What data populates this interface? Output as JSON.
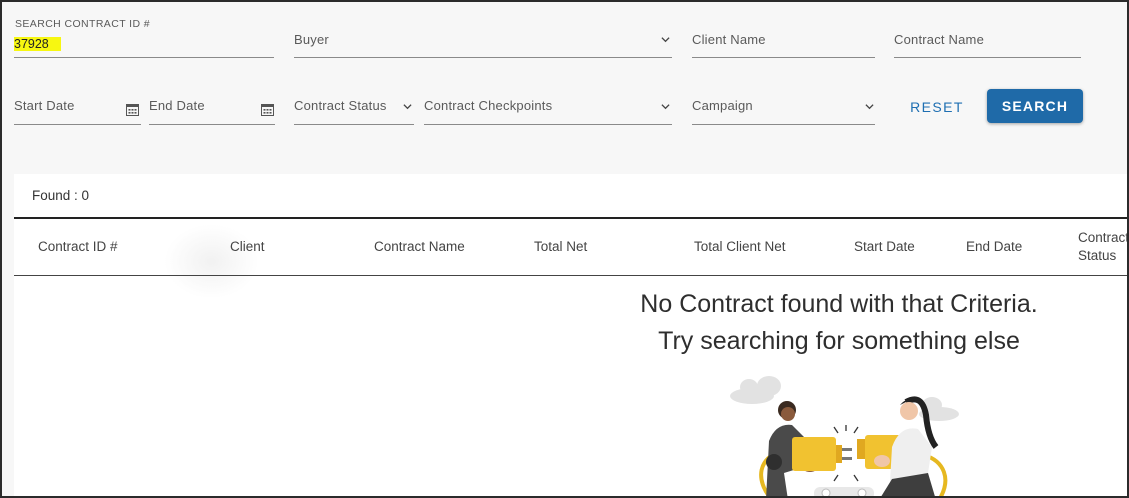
{
  "filters": {
    "contract_id": {
      "label": "SEARCH CONTRACT ID #",
      "value": "37928"
    },
    "buyer": {
      "label": "Buyer"
    },
    "client_name": {
      "label": "Client Name"
    },
    "contract_name": {
      "label": "Contract Name"
    },
    "start_date": {
      "label": "Start Date"
    },
    "end_date": {
      "label": "End Date"
    },
    "contract_status": {
      "label": "Contract Status"
    },
    "contract_checkpoints": {
      "label": "Contract Checkpoints"
    },
    "campaign": {
      "label": "Campaign"
    }
  },
  "actions": {
    "reset": "RESET",
    "search": "SEARCH"
  },
  "results": {
    "found": "Found : 0",
    "columns": {
      "contract_id": "Contract ID #",
      "client": "Client",
      "contract_name": "Contract Name",
      "total_net": "Total Net",
      "total_client_net": "Total Client Net",
      "start_date": "Start Date",
      "end_date": "End Date",
      "contract_status_line1": "Contract",
      "contract_status_line2": "Status"
    },
    "empty_line1": "No Contract found with that Criteria.",
    "empty_line2": "Try searching for something else"
  },
  "colors": {
    "accent": "#1f6aa8",
    "highlight": "#f7f711"
  },
  "icons": [
    "chevron-down-icon",
    "calendar-icon"
  ]
}
